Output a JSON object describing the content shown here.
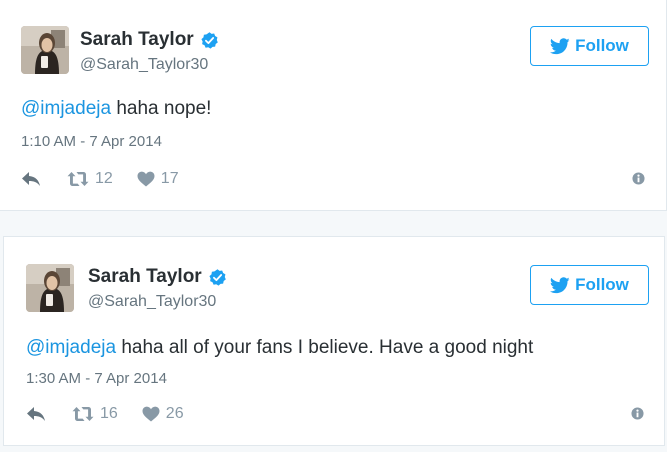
{
  "colors": {
    "accent": "#1da1f2",
    "mention": "#1b95e0",
    "secondary_text": "#66757f",
    "icon": "#8899a6"
  },
  "tweets": [
    {
      "author": {
        "display_name": "Sarah Taylor",
        "handle": "@Sarah_Taylor30",
        "verified": true
      },
      "follow_label": "Follow",
      "mention": "@imjadeja",
      "text": " haha nope!",
      "timestamp": "1:10 AM - 7 Apr 2014",
      "retweet_count": "12",
      "like_count": "17",
      "icons": [
        "reply-icon",
        "retweet-icon",
        "heart-icon",
        "info-icon",
        "verified-badge-icon",
        "twitter-bird-icon"
      ]
    },
    {
      "author": {
        "display_name": "Sarah Taylor",
        "handle": "@Sarah_Taylor30",
        "verified": true
      },
      "follow_label": "Follow",
      "mention": "@imjadeja",
      "text": " haha all of your fans I believe. Have a good night",
      "timestamp": "1:30 AM - 7 Apr 2014",
      "retweet_count": "16",
      "like_count": "26",
      "icons": [
        "reply-icon",
        "retweet-icon",
        "heart-icon",
        "info-icon",
        "verified-badge-icon",
        "twitter-bird-icon"
      ]
    }
  ]
}
